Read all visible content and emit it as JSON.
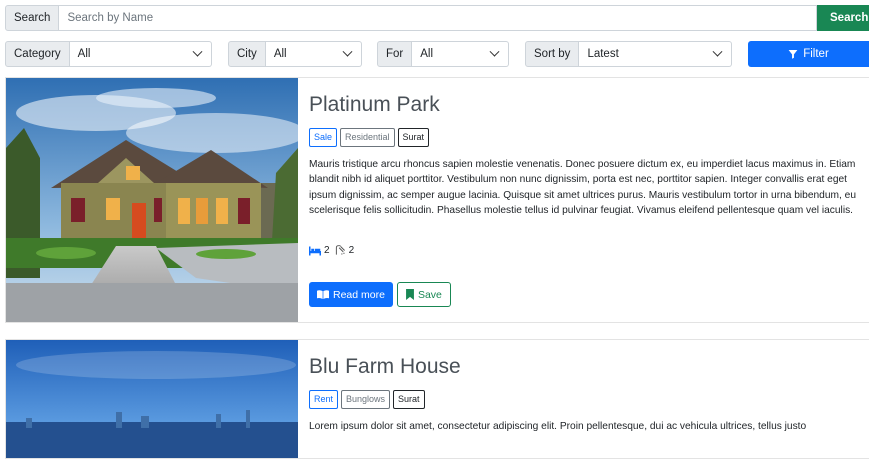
{
  "search": {
    "label": "Search",
    "placeholder": "Search by Name",
    "button_label": "Search"
  },
  "filters": {
    "category": {
      "label": "Category",
      "value": "All"
    },
    "city": {
      "label": "City",
      "value": "All"
    },
    "for": {
      "label": "For",
      "value": "All"
    },
    "sort": {
      "label": "Sort by",
      "value": "Latest"
    },
    "button_label": "Filter"
  },
  "listings": [
    {
      "title": "Platinum Park",
      "badges": [
        "Sale",
        "Residential",
        "Surat"
      ],
      "description": "Mauris tristique arcu rhoncus sapien molestie venenatis. Donec posuere dictum ex, eu imperdiet lacus maximus in. Etiam blandit nibh id aliquet porttitor. Vestibulum non nunc dignissim, porta est nec, porttitor sapien. Integer convallis erat eget ipsum dignissim, ac semper augue lacinia. Quisque sit amet ultrices purus. Mauris vestibulum tortor in urna bibendum, eu scelerisque felis sollicitudin. Phasellus molestie tellus id pulvinar feugiat. Vivamus eleifend pellentesque quam vel iaculis.",
      "beds": "2",
      "baths": "2",
      "read_more_label": "Read more",
      "save_label": "Save"
    },
    {
      "title": "Blu Farm House",
      "badges": [
        "Rent",
        "Bunglows",
        "Surat"
      ],
      "description": "Lorem ipsum dolor sit amet, consectetur adipiscing elit. Proin pellentesque, dui ac vehicula ultrices, tellus justo"
    }
  ],
  "colors": {
    "primary": "#0d6efd",
    "success": "#198754",
    "addon_bg": "#e9ecef",
    "title": "#495057"
  },
  "icons": {
    "search_button": "search-icon",
    "filter_button": "funnel-icon",
    "beds": "bed-icon",
    "baths": "shower-icon",
    "read_more": "book-icon",
    "save": "bookmark-icon"
  }
}
